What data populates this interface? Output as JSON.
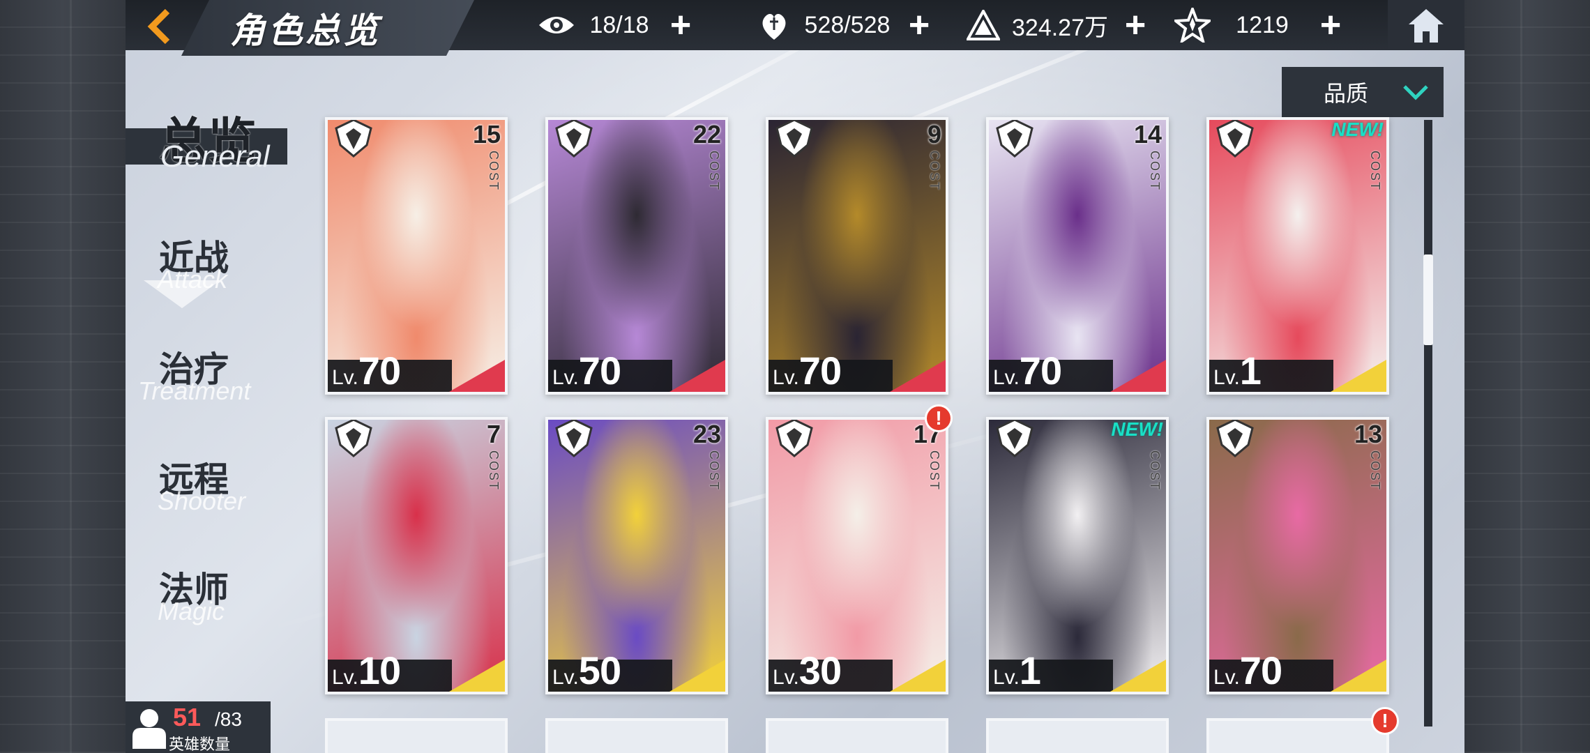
{
  "header": {
    "title": "角色总览",
    "resources": [
      {
        "icon": "eye-icon",
        "value": "18/18"
      },
      {
        "icon": "stamina-heart-icon",
        "value": "528/528"
      },
      {
        "icon": "triangle-gem-icon",
        "value": "324.27万"
      },
      {
        "icon": "star-crystal-icon",
        "value": "1219"
      }
    ]
  },
  "filter": {
    "quality_label": "品质"
  },
  "nav": [
    {
      "cn": "总览",
      "en": "General",
      "active": true
    },
    {
      "cn": "近战",
      "en": "Attack"
    },
    {
      "cn": "治疗",
      "en": "Treatment"
    },
    {
      "cn": "远程",
      "en": "Shooter"
    },
    {
      "cn": "法师",
      "en": "Magic"
    }
  ],
  "cost_label": "COST",
  "level_prefix": "Lv.",
  "new_label": "NEW!",
  "cards": [
    {
      "cost": "15",
      "level": "70",
      "rarity_color": "#e03a4e",
      "art": [
        "#f08a6c",
        "#f6efe6"
      ],
      "class_icon": "shield-crest-icon"
    },
    {
      "cost": "22",
      "level": "70",
      "rarity_color": "#e03a4e",
      "art": [
        "#b688d6",
        "#2e2a33"
      ],
      "class_icon": "mace-crest-icon"
    },
    {
      "cost": "9",
      "level": "70",
      "rarity_color": "#e03a4e",
      "art": [
        "#2a2433",
        "#b48a2a"
      ],
      "class_icon": "sword-crest-icon"
    },
    {
      "cost": "14",
      "level": "70",
      "rarity_color": "#e03a4e",
      "art": [
        "#e8e4f2",
        "#6a2f8a"
      ],
      "class_icon": "staff-crest-icon"
    },
    {
      "cost": "",
      "level": "1",
      "rarity_color": "#f2d13a",
      "art": [
        "#e64a5c",
        "#f4f0ee"
      ],
      "class_icon": "wing-crest-icon",
      "new": true
    },
    {
      "cost": "7",
      "level": "10",
      "rarity_color": "#f2d13a",
      "art": [
        "#c9d4e2",
        "#d8304a"
      ],
      "class_icon": "shuriken-icon"
    },
    {
      "cost": "23",
      "level": "50",
      "rarity_color": "#f2d13a",
      "art": [
        "#6a4bc4",
        "#f2d13a"
      ],
      "class_icon": "horned-skull-icon"
    },
    {
      "cost": "17",
      "level": "30",
      "rarity_color": "#f2d13a",
      "art": [
        "#f29aa6",
        "#f4efe8"
      ],
      "class_icon": "cross-crest-icon",
      "alert": true
    },
    {
      "cost": "",
      "level": "1",
      "rarity_color": "#f2d13a",
      "art": [
        "#2c2a3a",
        "#f2f0f2"
      ],
      "class_icon": "fox-mask-icon",
      "new": true
    },
    {
      "cost": "13",
      "level": "70",
      "rarity_color": "#f2d13a",
      "art": [
        "#8a6a4a",
        "#e86aa4"
      ],
      "class_icon": "heart-crest-icon"
    }
  ],
  "hero_count": {
    "owned": "51",
    "total": "/83",
    "label": "英雄数量"
  }
}
